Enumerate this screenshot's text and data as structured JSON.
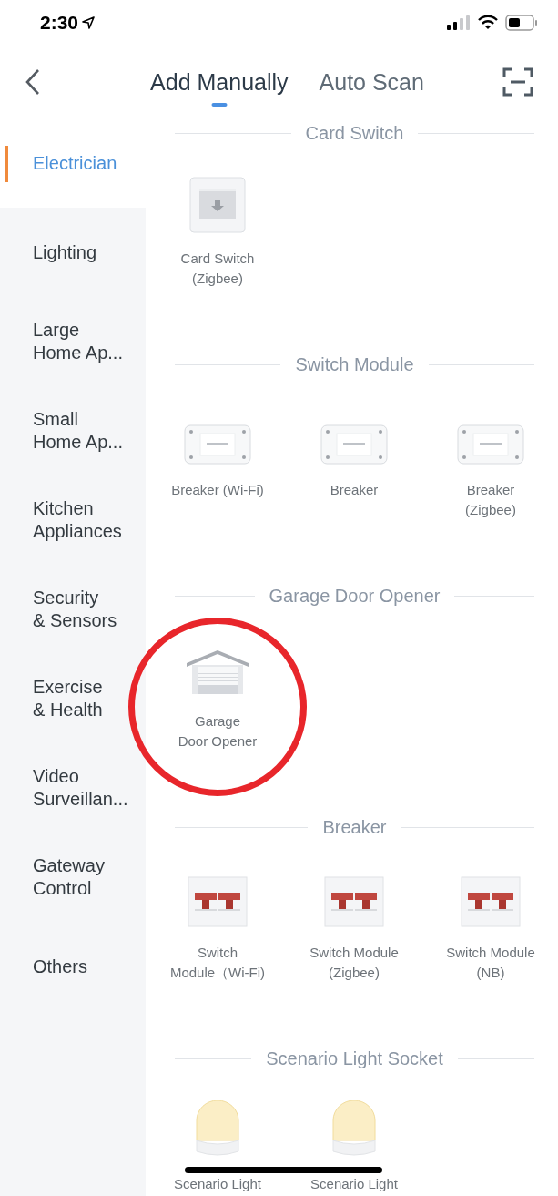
{
  "status_bar": {
    "time": "2:30"
  },
  "nav": {
    "tabs": [
      {
        "label": "Add Manually",
        "selected": true
      },
      {
        "label": "Auto Scan",
        "selected": false
      }
    ]
  },
  "sidebar": {
    "items": [
      {
        "lines": [
          "Electrician"
        ],
        "selected": true
      },
      {
        "lines": [
          "Lighting"
        ],
        "selected": false
      },
      {
        "lines": [
          "Large",
          "Home Ap..."
        ],
        "selected": false
      },
      {
        "lines": [
          "Small",
          "Home Ap..."
        ],
        "selected": false
      },
      {
        "lines": [
          "Kitchen",
          "Appliances"
        ],
        "selected": false
      },
      {
        "lines": [
          "Security",
          "& Sensors"
        ],
        "selected": false
      },
      {
        "lines": [
          "Exercise",
          "& Health"
        ],
        "selected": false
      },
      {
        "lines": [
          "Video",
          "Surveillan..."
        ],
        "selected": false
      },
      {
        "lines": [
          "Gateway",
          "Control"
        ],
        "selected": false
      },
      {
        "lines": [
          "Others"
        ],
        "selected": false
      }
    ]
  },
  "sections": [
    {
      "title": "Card Switch",
      "items": [
        {
          "kind": "card",
          "lines": [
            "Card Switch",
            "(Zigbee)"
          ],
          "circled": false
        }
      ]
    },
    {
      "title": "Switch Module",
      "items": [
        {
          "kind": "module",
          "lines": [
            "Breaker (Wi-Fi)"
          ],
          "circled": false
        },
        {
          "kind": "module",
          "lines": [
            "Breaker"
          ],
          "circled": false
        },
        {
          "kind": "module",
          "lines": [
            "Breaker",
            "(Zigbee)"
          ],
          "circled": false
        }
      ]
    },
    {
      "title": "Garage Door Opener",
      "items": [
        {
          "kind": "garage",
          "lines": [
            "Garage",
            "Door Opener"
          ],
          "circled": true
        }
      ]
    },
    {
      "title": "Breaker",
      "items": [
        {
          "kind": "breaker",
          "lines": [
            "Switch",
            "Module（Wi-Fi)"
          ],
          "circled": false
        },
        {
          "kind": "breaker",
          "lines": [
            "Switch Module",
            "(Zigbee)"
          ],
          "circled": false
        },
        {
          "kind": "breaker",
          "lines": [
            "Switch Module",
            "(NB)"
          ],
          "circled": false
        }
      ]
    },
    {
      "title": "Scenario Light Socket",
      "items": [
        {
          "kind": "bulb",
          "lines": [
            "Scenario Light"
          ],
          "circled": false
        },
        {
          "kind": "bulb",
          "lines": [
            "Scenario Light"
          ],
          "circled": false
        }
      ]
    }
  ]
}
